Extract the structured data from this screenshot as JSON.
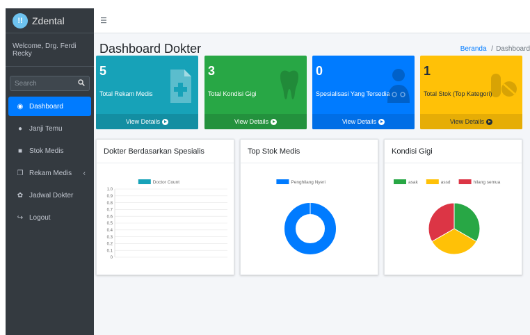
{
  "brand": {
    "name": "Zdental",
    "logo_text": "!!"
  },
  "sidebar": {
    "welcome": "Welcome, Drg. Ferdi Recky",
    "search_placeholder": "Search",
    "items": [
      {
        "label": "Dashboard",
        "icon": "dashboard-icon",
        "glyph": "◉",
        "active": true
      },
      {
        "label": "Janji Temu",
        "icon": "comment-icon",
        "glyph": "●"
      },
      {
        "label": "Stok Medis",
        "icon": "briefcase-icon",
        "glyph": "■"
      },
      {
        "label": "Rekam Medis",
        "icon": "copy-icon",
        "glyph": "❐"
      },
      {
        "label": "Jadwal Dokter",
        "icon": "cog-icon",
        "glyph": "✿"
      },
      {
        "label": "Logout",
        "icon": "sign-out-icon",
        "glyph": "↪"
      }
    ]
  },
  "header": {
    "menu_icon": "hamburger-icon",
    "title": "Dashboard Dokter",
    "breadcrumb_home": "Beranda",
    "breadcrumb_sep": "/",
    "breadcrumb_current": "Dashboard"
  },
  "stats": [
    {
      "value": "5",
      "label": "Total Rekam Medis",
      "footer": "View Details",
      "icon": "file-medical-icon",
      "color": "#17a2b8"
    },
    {
      "value": "3",
      "label": "Total Kondisi Gigi",
      "footer": "View Details",
      "icon": "tooth-icon",
      "color": "#28a745"
    },
    {
      "value": "0",
      "label": "Spesialisasi Yang Tersedia",
      "footer": "View Details",
      "icon": "user-md-icon",
      "color": "#007bff"
    },
    {
      "value": "1",
      "label": "Total Stok (Top Kategori)",
      "footer": "View Details",
      "icon": "pills-icon",
      "color": "#ffc107"
    }
  ],
  "cards": {
    "specialist": {
      "title": "Dokter Berdasarkan Spesialis"
    },
    "stock": {
      "title": "Top Stok Medis"
    },
    "teeth": {
      "title": "Kondisi Gigi"
    }
  },
  "chart_data": [
    {
      "type": "bar",
      "title": "",
      "categories": [],
      "series": [
        {
          "name": "Doctor Count",
          "values": []
        }
      ],
      "ylim": [
        0,
        1.0
      ],
      "yticks": [
        "1.0",
        "0.9",
        "0.8",
        "0.7",
        "0.6",
        "0.5",
        "0.4",
        "0.3",
        "0.2",
        "0.1",
        "0"
      ],
      "grid": true,
      "legend": "top",
      "colors": [
        "#17a2b8"
      ]
    },
    {
      "type": "pie",
      "variant": "doughnut",
      "categories": [
        "Penghilang Nyeri"
      ],
      "values": [
        1
      ],
      "legend": "top",
      "colors": [
        "#007bff"
      ]
    },
    {
      "type": "pie",
      "categories": [
        "asak",
        "assd",
        "hilang semua"
      ],
      "values": [
        1,
        1,
        1
      ],
      "legend": "top",
      "colors": [
        "#28a745",
        "#ffc107",
        "#dc3545"
      ]
    }
  ]
}
